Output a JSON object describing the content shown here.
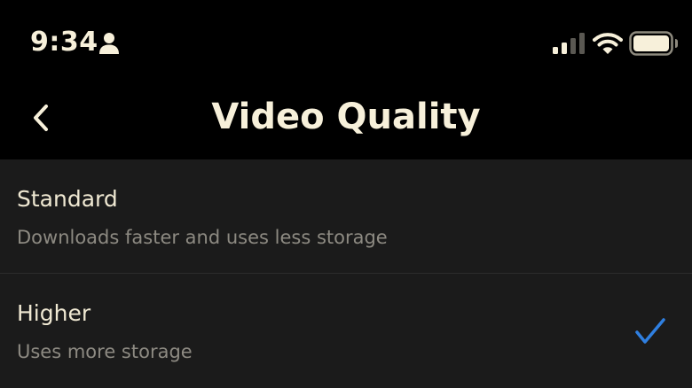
{
  "status_bar": {
    "time": "9:34",
    "icons": [
      "person-icon",
      "cellular-signal-icon",
      "wifi-icon",
      "battery-icon"
    ]
  },
  "header": {
    "title": "Video Quality",
    "back_icon": "chevron-left-icon"
  },
  "options": [
    {
      "title": "Standard",
      "subtitle": "Downloads faster and uses less storage",
      "selected": false
    },
    {
      "title": "Higher",
      "subtitle": "Uses more storage",
      "selected": true
    }
  ],
  "colors": {
    "background": "#000000",
    "list_background": "#1b1b1b",
    "text_primary": "#f7f0da",
    "text_secondary": "#8d8a82",
    "accent_check": "#2f7fe0"
  }
}
